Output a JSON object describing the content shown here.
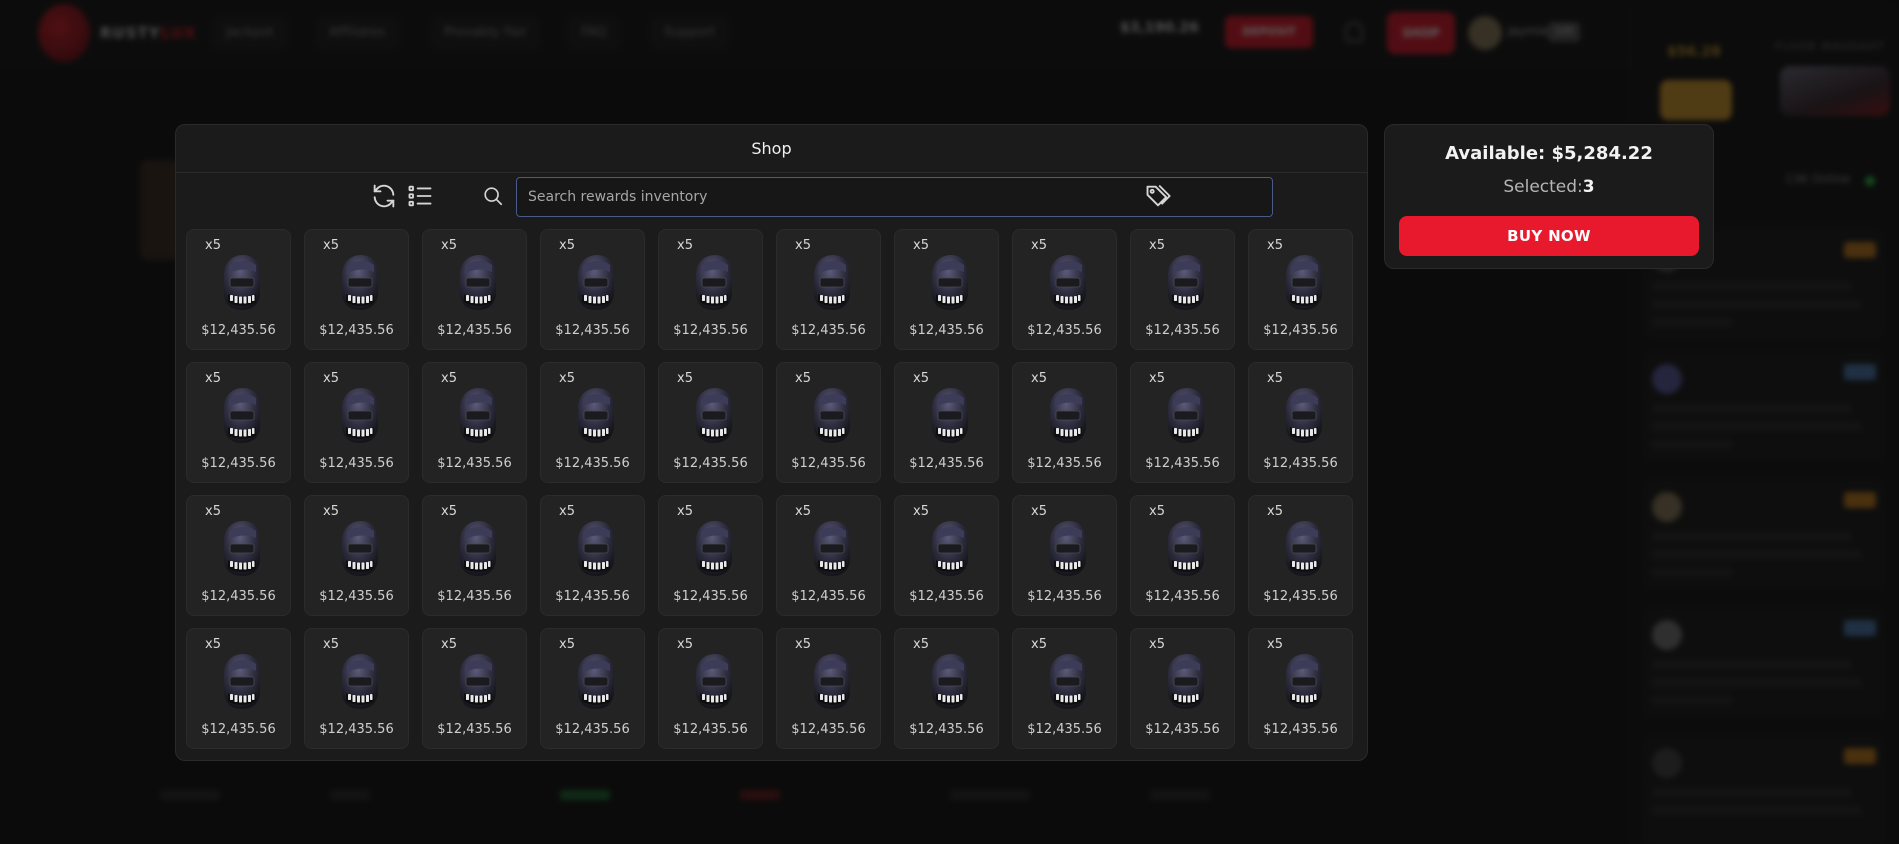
{
  "background": {
    "logo_text": "RUSTYLUX",
    "logo_text_accent": "LUX",
    "logo_text_main": "RUSTY",
    "nav": [
      "Jackpot",
      "Affiliates",
      "Provably Fair",
      "FAQ",
      "Support"
    ],
    "balance": "$3,190.26",
    "deposit_label": "DEPOSIT",
    "shop_label": "SHOP",
    "username": "Jaymie",
    "level": "100",
    "side_price": "$56.28",
    "side_title": "FLOOR MAHDAHT",
    "online_label": "136 Online"
  },
  "shop": {
    "title": "Shop",
    "search_placeholder": "Search rewards inventory",
    "icons": {
      "refresh": "refresh-icon",
      "list": "list-icon",
      "search": "search-icon",
      "tags": "tags-icon"
    },
    "items": [
      {
        "qty": "x5",
        "price": "$12,435.56"
      },
      {
        "qty": "x5",
        "price": "$12,435.56"
      },
      {
        "qty": "x5",
        "price": "$12,435.56"
      },
      {
        "qty": "x5",
        "price": "$12,435.56"
      },
      {
        "qty": "x5",
        "price": "$12,435.56"
      },
      {
        "qty": "x5",
        "price": "$12,435.56"
      },
      {
        "qty": "x5",
        "price": "$12,435.56"
      },
      {
        "qty": "x5",
        "price": "$12,435.56"
      },
      {
        "qty": "x5",
        "price": "$12,435.56"
      },
      {
        "qty": "x5",
        "price": "$12,435.56"
      },
      {
        "qty": "x5",
        "price": "$12,435.56"
      },
      {
        "qty": "x5",
        "price": "$12,435.56"
      },
      {
        "qty": "x5",
        "price": "$12,435.56"
      },
      {
        "qty": "x5",
        "price": "$12,435.56"
      },
      {
        "qty": "x5",
        "price": "$12,435.56"
      },
      {
        "qty": "x5",
        "price": "$12,435.56"
      },
      {
        "qty": "x5",
        "price": "$12,435.56"
      },
      {
        "qty": "x5",
        "price": "$12,435.56"
      },
      {
        "qty": "x5",
        "price": "$12,435.56"
      },
      {
        "qty": "x5",
        "price": "$12,435.56"
      },
      {
        "qty": "x5",
        "price": "$12,435.56"
      },
      {
        "qty": "x5",
        "price": "$12,435.56"
      },
      {
        "qty": "x5",
        "price": "$12,435.56"
      },
      {
        "qty": "x5",
        "price": "$12,435.56"
      },
      {
        "qty": "x5",
        "price": "$12,435.56"
      },
      {
        "qty": "x5",
        "price": "$12,435.56"
      },
      {
        "qty": "x5",
        "price": "$12,435.56"
      },
      {
        "qty": "x5",
        "price": "$12,435.56"
      },
      {
        "qty": "x5",
        "price": "$12,435.56"
      },
      {
        "qty": "x5",
        "price": "$12,435.56"
      },
      {
        "qty": "x5",
        "price": "$12,435.56"
      },
      {
        "qty": "x5",
        "price": "$12,435.56"
      },
      {
        "qty": "x5",
        "price": "$12,435.56"
      },
      {
        "qty": "x5",
        "price": "$12,435.56"
      },
      {
        "qty": "x5",
        "price": "$12,435.56"
      },
      {
        "qty": "x5",
        "price": "$12,435.56"
      },
      {
        "qty": "x5",
        "price": "$12,435.56"
      },
      {
        "qty": "x5",
        "price": "$12,435.56"
      },
      {
        "qty": "x5",
        "price": "$12,435.56"
      },
      {
        "qty": "x5",
        "price": "$12,435.56"
      }
    ]
  },
  "summary": {
    "available": "Available: $5,284.22",
    "selected_label": "Selected:",
    "selected_count": "3",
    "buy_label": "BUY NOW"
  },
  "colors": {
    "accent_red": "#e8192c",
    "search_border": "#4a5a8a",
    "panel_bg": "#1b1b1b"
  }
}
